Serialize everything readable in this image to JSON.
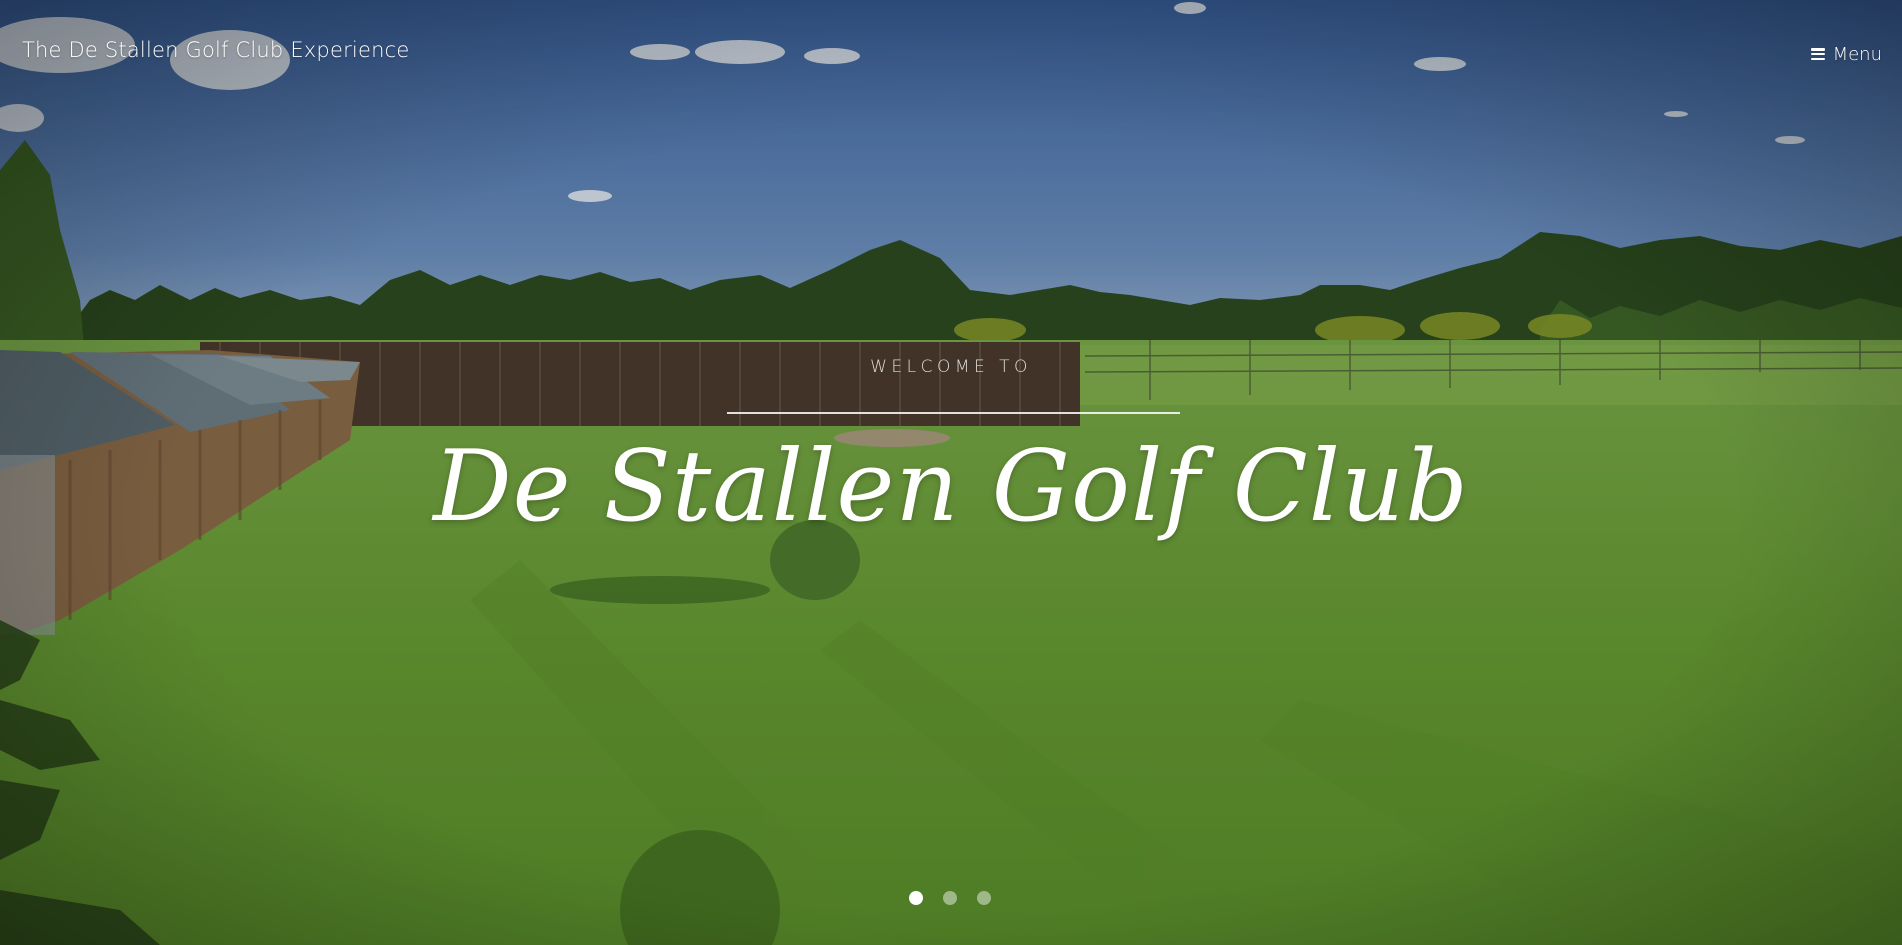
{
  "header": {
    "site_title": "The De Stallen Golf Club Experience",
    "menu_label": "Menu",
    "menu_icon": "hamburger-icon"
  },
  "hero": {
    "welcome": "WELCOME TO",
    "title": "De Stallen Golf Club",
    "slides": [
      {
        "active": true
      },
      {
        "active": false
      },
      {
        "active": false
      }
    ]
  },
  "colors": {
    "sky_top": "#3f6aa8",
    "sky_bottom": "#7a9cc4",
    "grass": "#6ea23b",
    "text": "#ffffff"
  }
}
